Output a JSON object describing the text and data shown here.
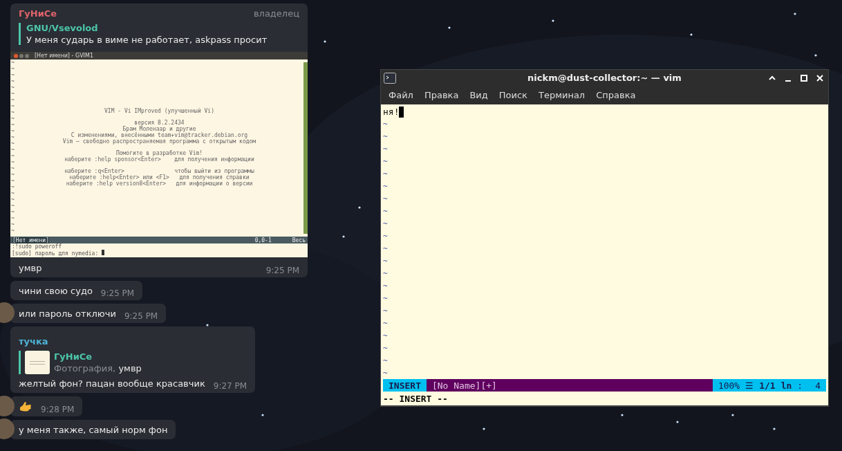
{
  "chat": {
    "messages": [
      {
        "kind": "photo_reply",
        "sender": "ГуНиСе",
        "color": "#e0636b",
        "role": "владелец",
        "avatar": false,
        "reply": {
          "author": "GNU/Vsevolod",
          "text": "У меня сударь в виме не работает, askpass просит"
        },
        "photo": {
          "title": "[Нет имени] - GVIM1",
          "tildes": [
            "~",
            "~",
            "~",
            "~",
            "~",
            "~",
            "~",
            "~",
            "~",
            "~",
            "~",
            "~",
            "~",
            "~",
            "~",
            "~",
            "~",
            "~",
            "~",
            "~",
            "~",
            "~",
            "~",
            "~",
            "~",
            "~",
            "~",
            "~"
          ],
          "intro": [
            [
              "VIM - Vi IMproved (улучшенный Vi)"
            ],
            [
              "версия 8.2.2434",
              "Брам Моленаар и другие",
              "С изменениями, внесёнными team+vim@tracker.debian.org",
              "Vim — свободно распространяемая программа с открытым кодом"
            ],
            [
              "Помогите в разработке Vim!",
              "наберите :help sponsor<Enter>    для получения информации"
            ],
            [
              "наберите :q<Enter>               чтобы выйти из программы",
              "наберите :help<Enter> или <F1>   для получения справки",
              "наберите :help version8<Enter>   для информации о версии"
            ]
          ],
          "status_name": "[Нет имени]",
          "status_pos": "0,0-1",
          "status_all": "Весь",
          "cmd": [
            ":!sudo poweroff",
            "[sudo] пароль для nymedia: "
          ]
        },
        "text": "умвр",
        "time": "9:25 PM"
      },
      {
        "kind": "text",
        "avatar": false,
        "text": "чини свою судо",
        "time": "9:25 PM"
      },
      {
        "kind": "text",
        "avatar": true,
        "text": "или пароль отключи",
        "time": "9:25 PM"
      },
      {
        "kind": "reply",
        "sender": "тучка",
        "color": "#4fb3d9",
        "avatar": false,
        "reply": {
          "author": "ГуНиСе",
          "label": "Фотография,",
          "text": "умвр"
        },
        "text": "желтый фон? пацан вообще красавчик",
        "time": "9:27 PM"
      },
      {
        "kind": "sticker",
        "avatar": true,
        "time": "9:28 PM"
      },
      {
        "kind": "text",
        "avatar": true,
        "text": "у меня также, самый норм фон"
      }
    ]
  },
  "terminal": {
    "title": "nickm@dust-collector:~ — vim",
    "menu": [
      "Файл",
      "Правка",
      "Вид",
      "Поиск",
      "Терминал",
      "Справка"
    ],
    "lines": [
      "ня!"
    ],
    "tildes": [
      "~",
      "~",
      "~",
      "~",
      "~",
      "~",
      "~",
      "~",
      "~",
      "~",
      "~",
      "~",
      "~",
      "~",
      "~",
      "~",
      "~",
      "~",
      "~",
      "~",
      "~"
    ],
    "status": {
      "mode": "INSERT",
      "file": "[No Name][+]",
      "percent": "100%",
      "menu_glyph": "☰",
      "position": "1/1",
      "ln": "ln",
      "colon": ":",
      "col": "4"
    },
    "cmdline": "-- INSERT --"
  }
}
